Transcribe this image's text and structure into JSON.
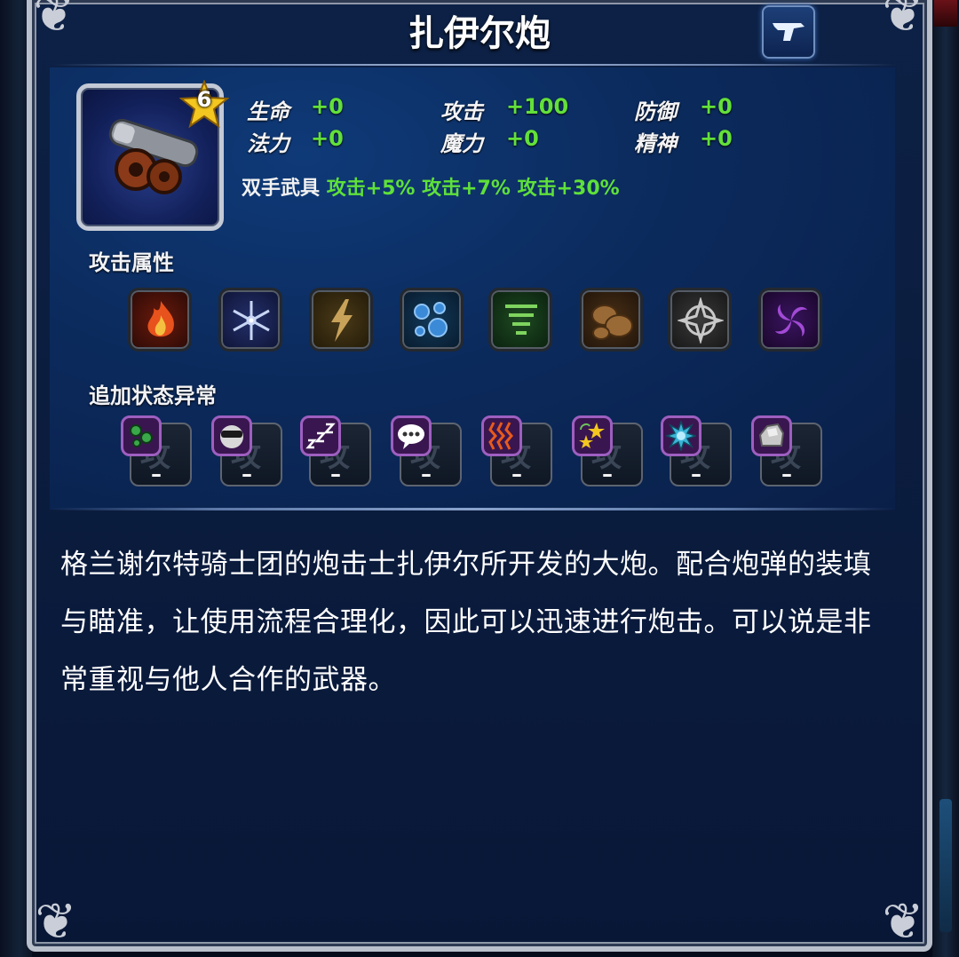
{
  "title": "扎伊尔炮",
  "item": {
    "rank": "6"
  },
  "stats": [
    {
      "label": "生命",
      "value": "+0"
    },
    {
      "label": "攻击",
      "value": "+100"
    },
    {
      "label": "防御",
      "value": "+0"
    },
    {
      "label": "法力",
      "value": "+0"
    },
    {
      "label": "魔力",
      "value": "+0"
    },
    {
      "label": "精神",
      "value": "+0"
    }
  ],
  "weapon_type": {
    "label": "双手武具",
    "bonuses": "攻击+5% 攻击+7% 攻击+30%"
  },
  "attack_attributes": {
    "label": "攻击属性",
    "elements": [
      {
        "name": "fire-icon",
        "color": "#d8421a"
      },
      {
        "name": "ice-icon",
        "color": "#6f86c8"
      },
      {
        "name": "lightning-icon",
        "color": "#c8a058"
      },
      {
        "name": "water-icon",
        "color": "#3c8ad0"
      },
      {
        "name": "wind-icon",
        "color": "#6cc25a"
      },
      {
        "name": "earth-icon",
        "color": "#9a6b3a"
      },
      {
        "name": "light-icon",
        "color": "#b8b8b8"
      },
      {
        "name": "dark-icon",
        "color": "#a04ad0"
      }
    ]
  },
  "status_ailments": {
    "label": "追加状态异常",
    "items": [
      {
        "name": "poison-icon",
        "value": "–"
      },
      {
        "name": "blind-icon",
        "value": "–"
      },
      {
        "name": "sleep-icon",
        "value": "–"
      },
      {
        "name": "silence-icon",
        "value": "–"
      },
      {
        "name": "paralysis-icon",
        "value": "–"
      },
      {
        "name": "confusion-icon",
        "value": "–"
      },
      {
        "name": "disease-icon",
        "value": "–"
      },
      {
        "name": "petrify-icon",
        "value": "–"
      }
    ],
    "ghost_char": "攻"
  },
  "description": "格兰谢尔特骑士团的炮击士扎伊尔所开发的大炮。配合炮弹的装填与瞄准，让使用流程合理化，因此可以迅速进行炮击。可以说是非常重视与他人合作的武器。"
}
